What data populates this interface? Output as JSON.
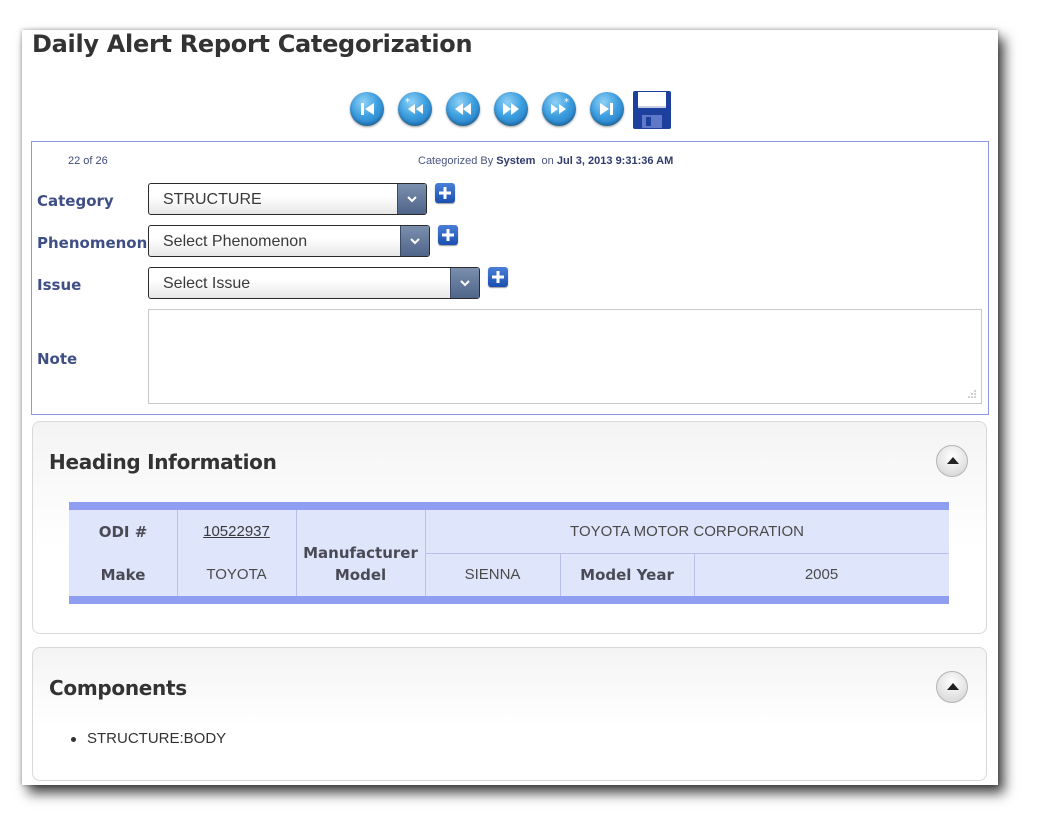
{
  "page": {
    "title": "Daily Alert Report Categorization"
  },
  "toolbar": {
    "buttons": [
      {
        "name": "first-record",
        "icon": "skip-first-icon"
      },
      {
        "name": "previous-uncategorized",
        "icon": "rewind-star-icon"
      },
      {
        "name": "previous-record",
        "icon": "rewind-icon"
      },
      {
        "name": "next-record",
        "icon": "fast-forward-icon"
      },
      {
        "name": "next-uncategorized",
        "icon": "fast-forward-star-icon"
      },
      {
        "name": "last-record",
        "icon": "skip-last-icon"
      }
    ],
    "save_icon": "floppy-disk-icon"
  },
  "record": {
    "position": "22 of 26",
    "categorized_prefix": "Categorized By",
    "categorized_by": "System",
    "on_label": "on",
    "categorized_on": "Jul 3, 2013 9:31:36 AM"
  },
  "form": {
    "category_label": "Category",
    "category_value": "STRUCTURE",
    "phenomenon_label": "Phenomenon",
    "phenomenon_value": "Select Phenomenon",
    "issue_label": "Issue",
    "issue_value": "Select Issue",
    "note_label": "Note",
    "note_value": ""
  },
  "heading_info": {
    "title": "Heading Information",
    "odi_label": "ODI #",
    "odi_value": "10522937",
    "manufacturer_label": "Manufacturer",
    "manufacturer_value": "TOYOTA MOTOR CORPORATION",
    "make_label": "Make",
    "make_value": "TOYOTA",
    "model_label": "Model",
    "model_value": "SIENNA",
    "model_year_label": "Model Year",
    "model_year_value": "2005"
  },
  "components": {
    "title": "Components",
    "items": [
      "STRUCTURE:BODY"
    ]
  },
  "colors": {
    "nav_button": "#3d9fe0",
    "panel_border": "#8e96e8",
    "table_band": "#8f9ef0",
    "table_fill": "#dfe6fb",
    "label_text": "#3f4f86"
  }
}
